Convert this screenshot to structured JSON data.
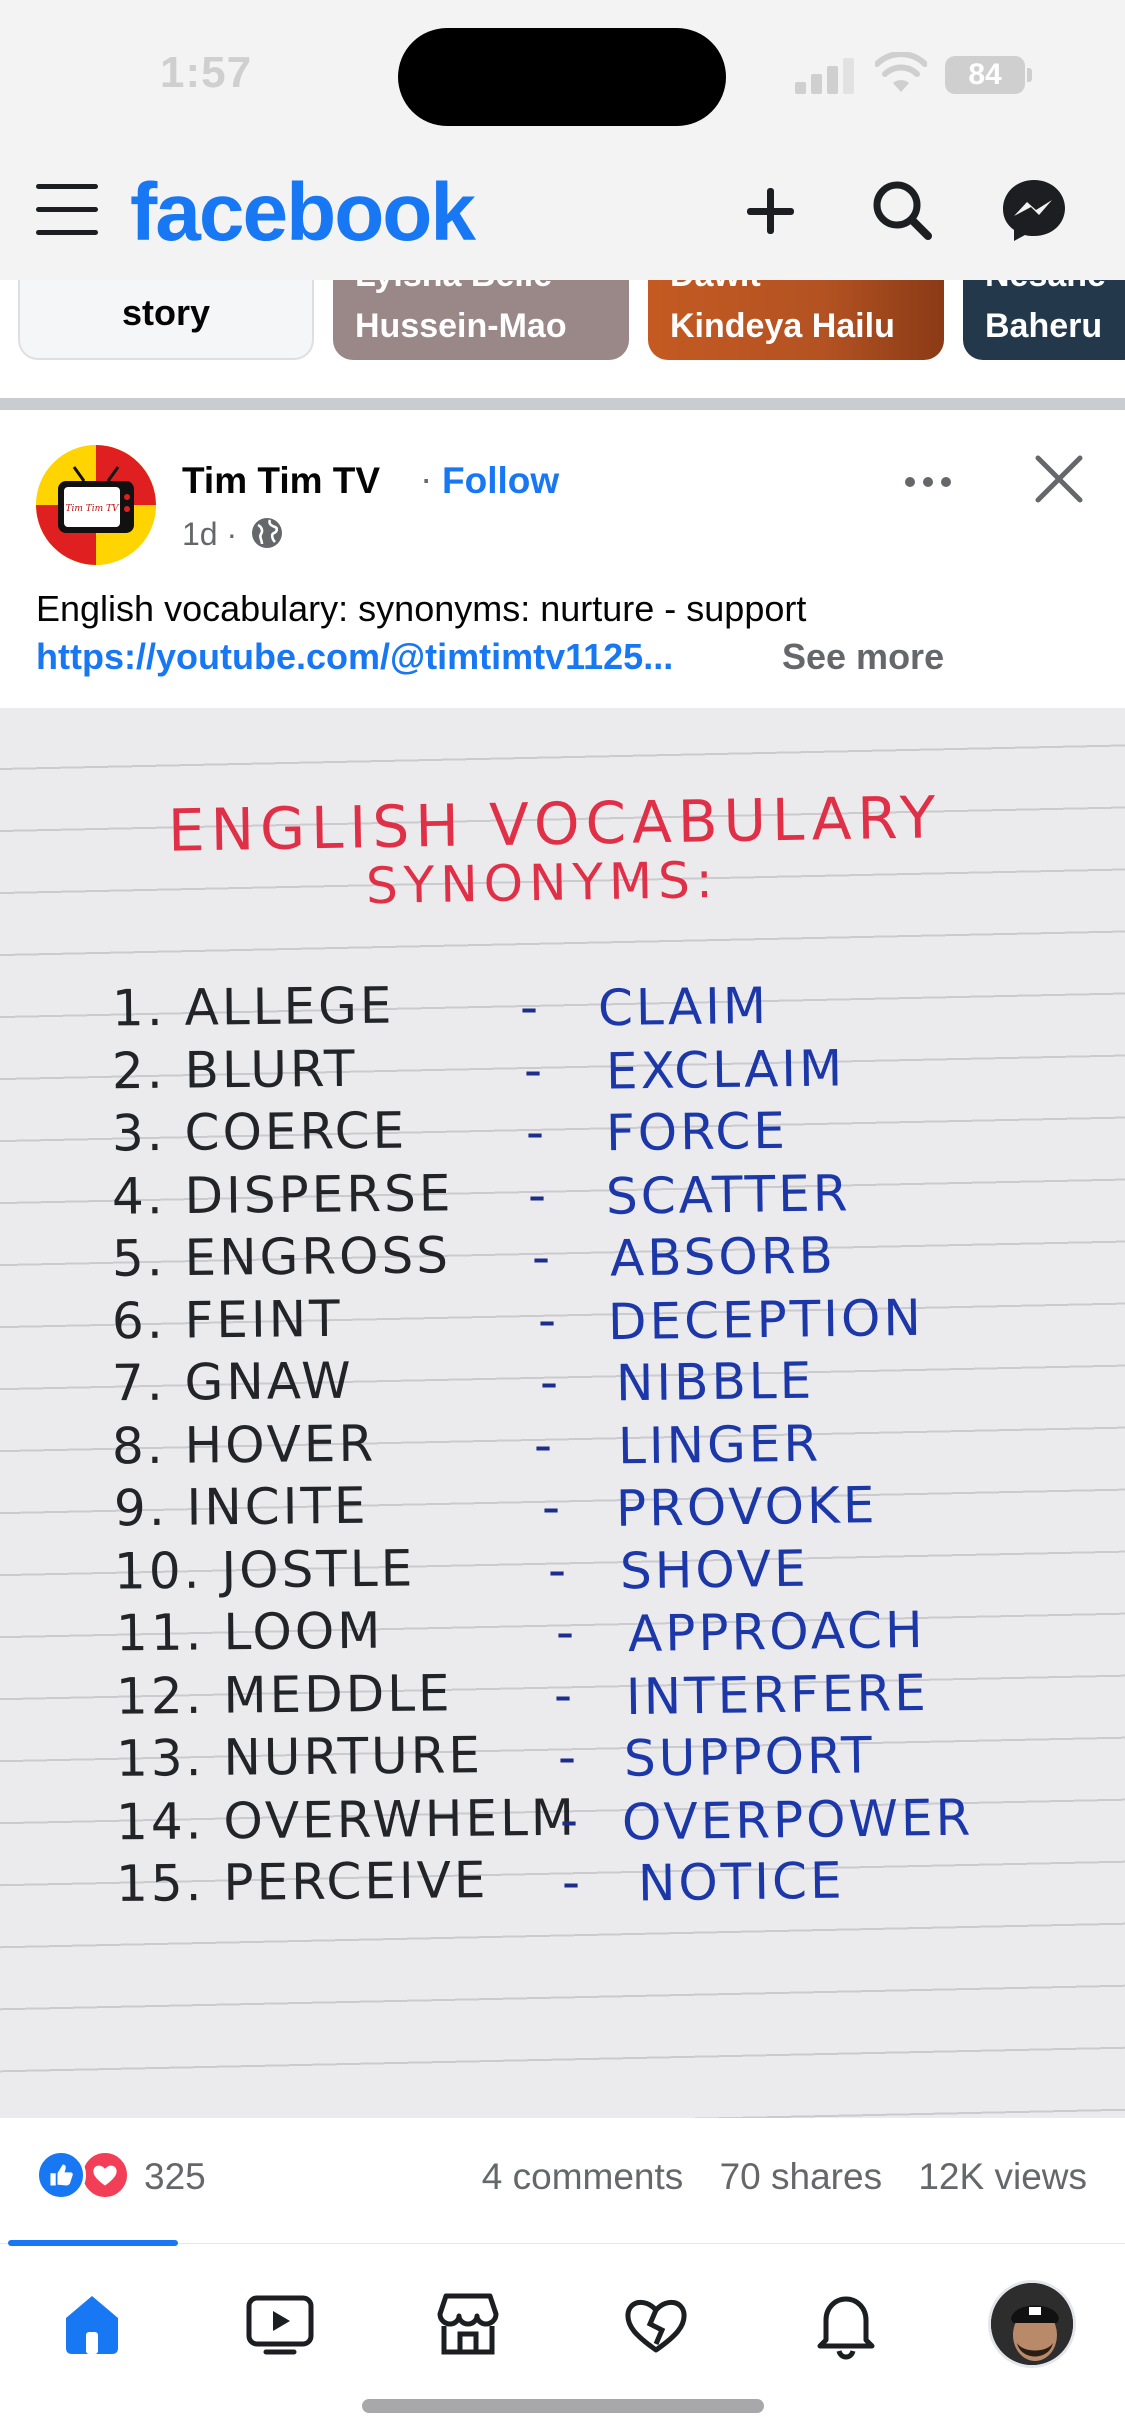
{
  "status_bar": {
    "time": "1:57",
    "battery": "84"
  },
  "header": {
    "logo": "facebook",
    "icons": [
      "menu-icon",
      "plus-icon",
      "search-icon",
      "messenger-icon"
    ],
    "brand_color": "#1877f2"
  },
  "stories": [
    {
      "name": "story"
    },
    {
      "name_top": "Lylsha Belle",
      "name": "Hussein-Mao"
    },
    {
      "name_top": "Dawit",
      "name": "Kindeya Hailu"
    },
    {
      "name_top": "Nesane",
      "name": "Baheru"
    }
  ],
  "post": {
    "author": "Tim Tim TV",
    "follow_label": "Follow",
    "time": "1d",
    "caption": "English vocabulary: synonyms: nurture - support",
    "link": "https://youtube.com/@timtimtv1125...",
    "see_more": "See more",
    "avatar_text": "Tim Tim TV"
  },
  "image": {
    "title_line1": "ENGLISH  VOCABULARY",
    "title_line2": "SYNONYMS:",
    "dash": "-",
    "entries": [
      {
        "word": "1. ALLEGE",
        "synonym": "CLAIM"
      },
      {
        "word": "2. BLURT",
        "synonym": "EXCLAIM"
      },
      {
        "word": "3. COERCE",
        "synonym": "FORCE"
      },
      {
        "word": "4. DISPERSE",
        "synonym": "SCATTER"
      },
      {
        "word": "5. ENGROSS",
        "synonym": "ABSORB"
      },
      {
        "word": "6. FEINT",
        "synonym": "DECEPTION"
      },
      {
        "word": "7. GNAW",
        "synonym": "NIBBLE"
      },
      {
        "word": "8. HOVER",
        "synonym": "LINGER"
      },
      {
        "word": "9. INCITE",
        "synonym": "PROVOKE"
      },
      {
        "word": "10. JOSTLE",
        "synonym": "SHOVE"
      },
      {
        "word": "11. LOOM",
        "synonym": "APPROACH"
      },
      {
        "word": "12. MEDDLE",
        "synonym": "INTERFERE"
      },
      {
        "word": "13. NURTURE",
        "synonym": "SUPPORT"
      },
      {
        "word": "14. OVERWHELM",
        "synonym": "OVERPOWER"
      },
      {
        "word": "15. PERCEIVE",
        "synonym": "NOTICE"
      }
    ]
  },
  "reactions": {
    "count": "325",
    "comments": "4 comments",
    "shares": "70 shares",
    "views": "12K views"
  },
  "bottom_nav": {
    "items": [
      "home-icon",
      "video-icon",
      "marketplace-icon",
      "dating-icon",
      "notifications-icon",
      "profile-avatar"
    ]
  }
}
